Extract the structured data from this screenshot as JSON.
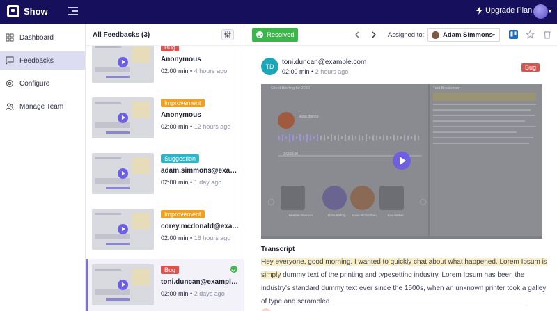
{
  "app": {
    "name": "Show",
    "upgrade_label": "Upgrade Plan"
  },
  "sidebar": {
    "items": [
      {
        "label": "Dashboard",
        "icon": "grid-icon",
        "active": false
      },
      {
        "label": "Feedbacks",
        "icon": "chat-icon",
        "active": true
      },
      {
        "label": "Configure",
        "icon": "gear-icon",
        "active": false
      },
      {
        "label": "Manage Team",
        "icon": "team-icon",
        "active": false
      }
    ]
  },
  "list": {
    "title": "All Feedbacks (3)",
    "items": [
      {
        "tag": "Bug",
        "tag_type": "bug",
        "user": "Anonymous",
        "duration": "02:00 min",
        "ago": "4 hours ago"
      },
      {
        "tag": "Improvement",
        "tag_type": "improvement",
        "user": "Anonymous",
        "duration": "02:00 min",
        "ago": "12 hours ago"
      },
      {
        "tag": "Suggestion",
        "tag_type": "suggestion",
        "user": "adam.simmons@example.com",
        "duration": "02:00 min",
        "ago": "1 day ago"
      },
      {
        "tag": "Improvement",
        "tag_type": "improvement",
        "user": "corey.mcdonald@example.com",
        "duration": "02:00 min",
        "ago": "16 hours ago"
      },
      {
        "tag": "Bug",
        "tag_type": "bug",
        "user": "toni.duncan@example.com",
        "duration": "02:00 min",
        "ago": "2 days ago",
        "selected": true,
        "resolved": true
      }
    ]
  },
  "detail": {
    "resolved_label": "Resolved",
    "assigned_label": "Assigned to:",
    "assignee": "Adam Simmons",
    "reporter": {
      "initials": "TD",
      "email": "toni.duncan@example.com",
      "duration": "02:00 min",
      "ago": "2 hours ago",
      "tag": "Bug"
    },
    "video": {
      "title": "Client Briefing for 2020",
      "sidebar_title": "Text Breakdown",
      "speaker": "Rosa Bishop",
      "time": "3:00/3:30",
      "participants": [
        "Heather Pearson",
        "Rosa Bishop",
        "Jesse Richardson",
        "Eva Walker"
      ]
    },
    "transcript_label": "Transcript",
    "transcript_highlight": "Hey everyone, good morning. I wanted to quickly chat about what happened. Lorem Ipsum is simply",
    "transcript_rest": "dummy text of the printing and typesetting industry. Lorem Ipsum has been the industry's standard dummy text ever since the 1500s, when an unknown printer took a galley of type and scrambled"
  },
  "colors": {
    "topbar": "#150f5c",
    "accent": "#6e5fe3",
    "resolved": "#3cb54a",
    "bug": "#d9534f",
    "improvement": "#f0a01e",
    "suggestion": "#2fb3c7"
  }
}
